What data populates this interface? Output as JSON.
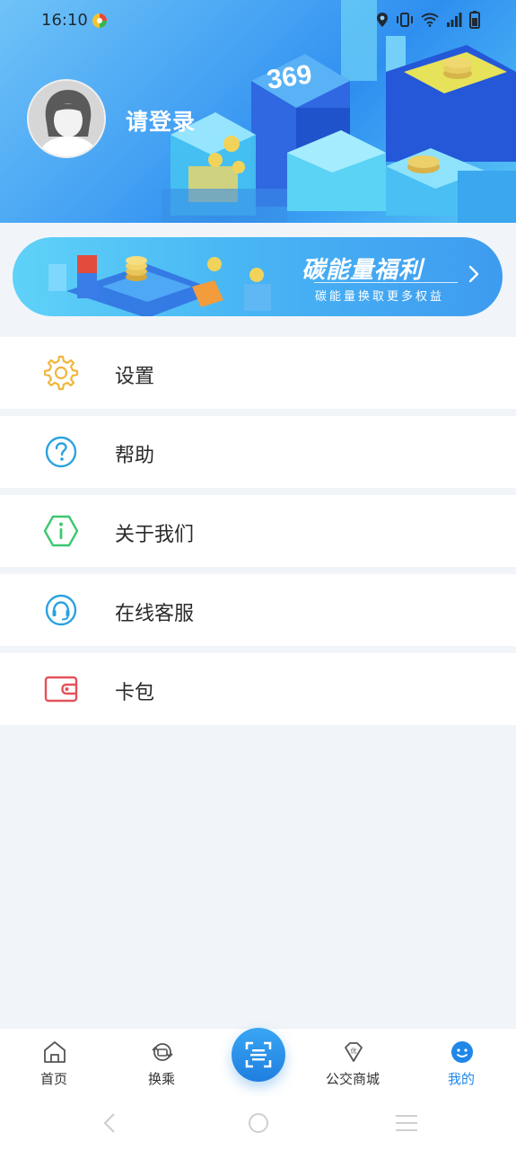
{
  "status_bar": {
    "time": "16:10",
    "icons": [
      "location-icon",
      "vibrate-icon",
      "wifi-icon",
      "signal-icon",
      "battery-icon"
    ]
  },
  "profile": {
    "login_text": "请登录",
    "avatar_icon": "default-avatar-icon"
  },
  "header_art": {
    "building_number": "369"
  },
  "banner": {
    "title": "碳能量福利",
    "subtitle": "碳能量换取更多权益",
    "arrow_icon": "chevron-right-icon"
  },
  "menu": {
    "items": [
      {
        "label": "设置",
        "icon": "gear-icon",
        "color": "#f0b73b"
      },
      {
        "label": "帮助",
        "icon": "help-circle-icon",
        "color": "#2aa2e0"
      },
      {
        "label": "关于我们",
        "icon": "info-hexagon-icon",
        "color": "#3cc870"
      },
      {
        "label": "在线客服",
        "icon": "headset-icon",
        "color": "#2aa2e0"
      },
      {
        "label": "卡包",
        "icon": "wallet-icon",
        "color": "#e4525a"
      }
    ]
  },
  "tabbar": {
    "tabs": [
      {
        "label": "首页",
        "icon": "home-icon",
        "active": false
      },
      {
        "label": "换乘",
        "icon": "transfer-icon",
        "active": false
      },
      {
        "label": "公交商城",
        "icon": "diamond-shop-icon",
        "active": false
      },
      {
        "label": "我的",
        "icon": "profile-icon",
        "active": true
      }
    ],
    "center_button_icon": "scan-icon",
    "accent_color": "#1f87e8"
  },
  "system_nav": {
    "icons": [
      "back-icon",
      "home-circle-icon",
      "recents-menu-icon"
    ]
  }
}
